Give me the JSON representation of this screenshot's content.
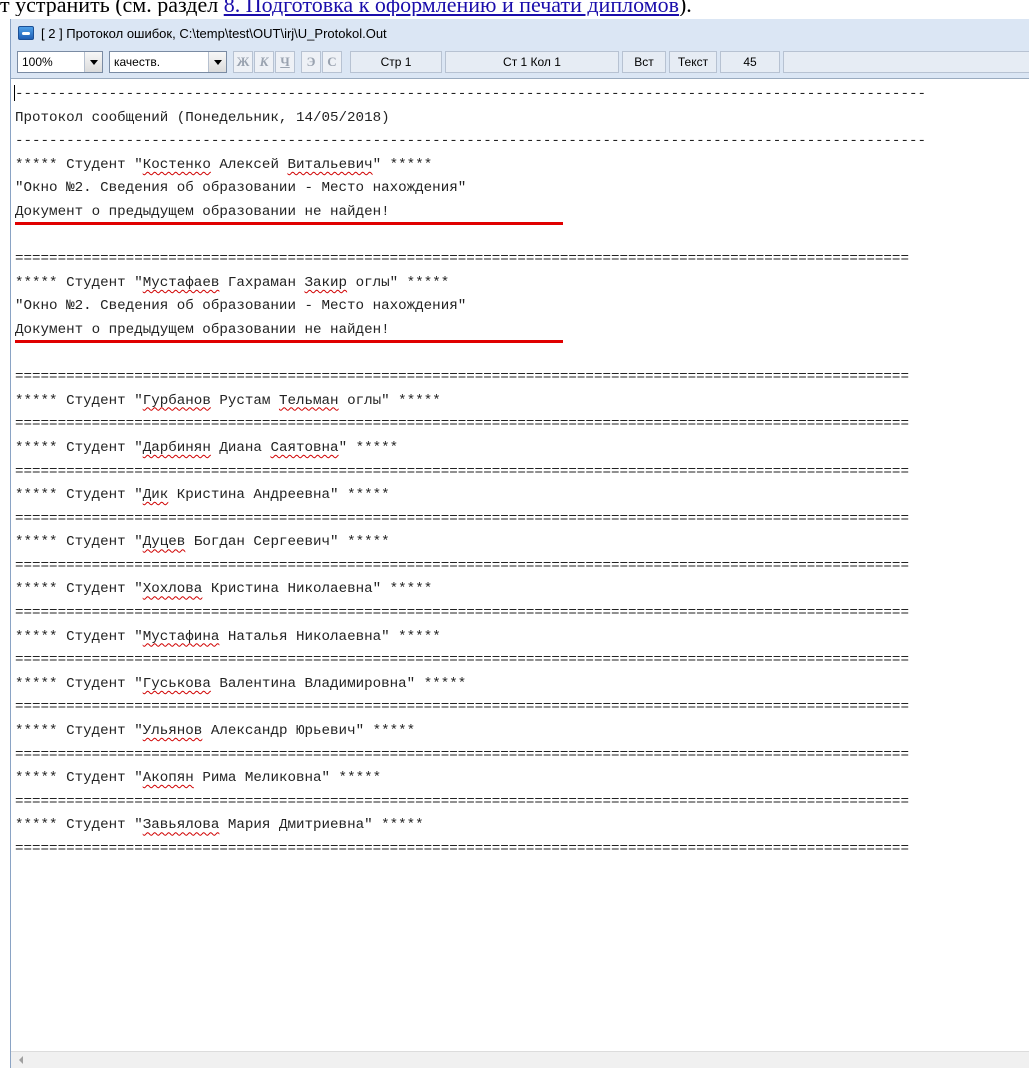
{
  "document": {
    "prefix": "т устранить (см. раздел ",
    "link_text": "8. Подготовка к оформлению и печати дипломов",
    "suffix": ")."
  },
  "window": {
    "title": "[ 2 ]  Протокол ошибок, C:\\temp\\test\\OUT\\irj\\U_Protokol.Out"
  },
  "toolbar": {
    "zoom": "100%",
    "quality": "качеств.",
    "format_buttons": [
      "Ж",
      "К",
      "Ч",
      "Э",
      "С"
    ],
    "page": "Стр 1",
    "position": "Ст 1  Кол 1",
    "insert_mode": "Вст",
    "mode": "Текст",
    "count": "45"
  },
  "log": {
    "separator_dash": "-----------------------------------------------------------------------------------------------------------",
    "separator_equal": "=========================================================================================================",
    "header": "Протокол сообщений (Понедельник, 14/05/2018)",
    "entries": [
      {
        "student": "Костенко Алексей Витальевич",
        "window": "\"Окно №2. Сведения об образовании - Место нахождения\"",
        "error": "Документ о предыдущем образовании не найден!"
      },
      {
        "student": "Мустафаев Гахраман Закир оглы",
        "window": "\"Окно №2. Сведения об образовании - Место нахождения\"",
        "error": "Документ о предыдущем образовании не найден!"
      },
      {
        "student": "Гурбанов Рустам Тельман оглы"
      },
      {
        "student": "Дарбинян Диана Саятовна"
      },
      {
        "student": "Дик Кристина Андреевна"
      },
      {
        "student": "Дуцев Богдан Сергеевич"
      },
      {
        "student": "Хохлова Кристина Николаевна"
      },
      {
        "student": "Мустафина Наталья Николаевна"
      },
      {
        "student": "Гуськова Валентина Владимировна"
      },
      {
        "student": "Ульянов Александр Юрьевич"
      },
      {
        "student": "Акопян Рима Меликовна"
      },
      {
        "student": "Завьялова Мария Дмитриевна"
      }
    ]
  },
  "colors": {
    "error_underline": "#e00000",
    "link": "#1a0dab",
    "window_chrome": "#dbe6f4"
  }
}
